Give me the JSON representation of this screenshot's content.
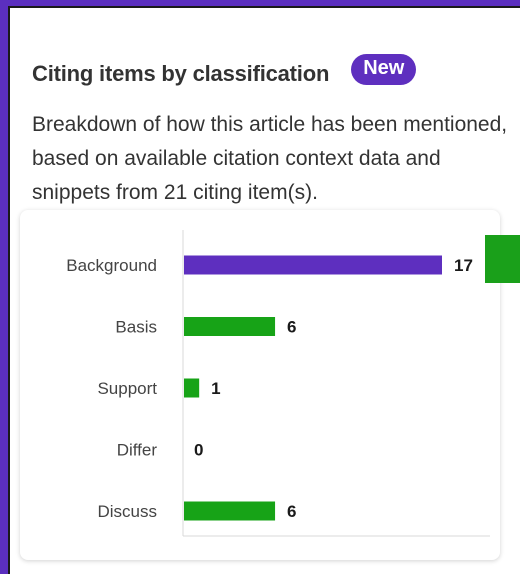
{
  "header": {
    "title": "Citing items by classification",
    "badge": "New"
  },
  "description": "Breakdown of how this article has been mentioned, based on available citation context data and snippets from 21 citing item(s).",
  "colors": {
    "highlight_bar": "#5e2fbf",
    "bar": "#17a317",
    "frame": "#5b2fbf"
  },
  "chart_data": {
    "type": "bar",
    "orientation": "horizontal",
    "categories": [
      "Background",
      "Basis",
      "Support",
      "Differ",
      "Discuss"
    ],
    "values": [
      17,
      6,
      1,
      0,
      6
    ],
    "highlighted_category": "Background",
    "xlim": [
      0,
      17
    ],
    "grid": false,
    "legend": "none"
  }
}
